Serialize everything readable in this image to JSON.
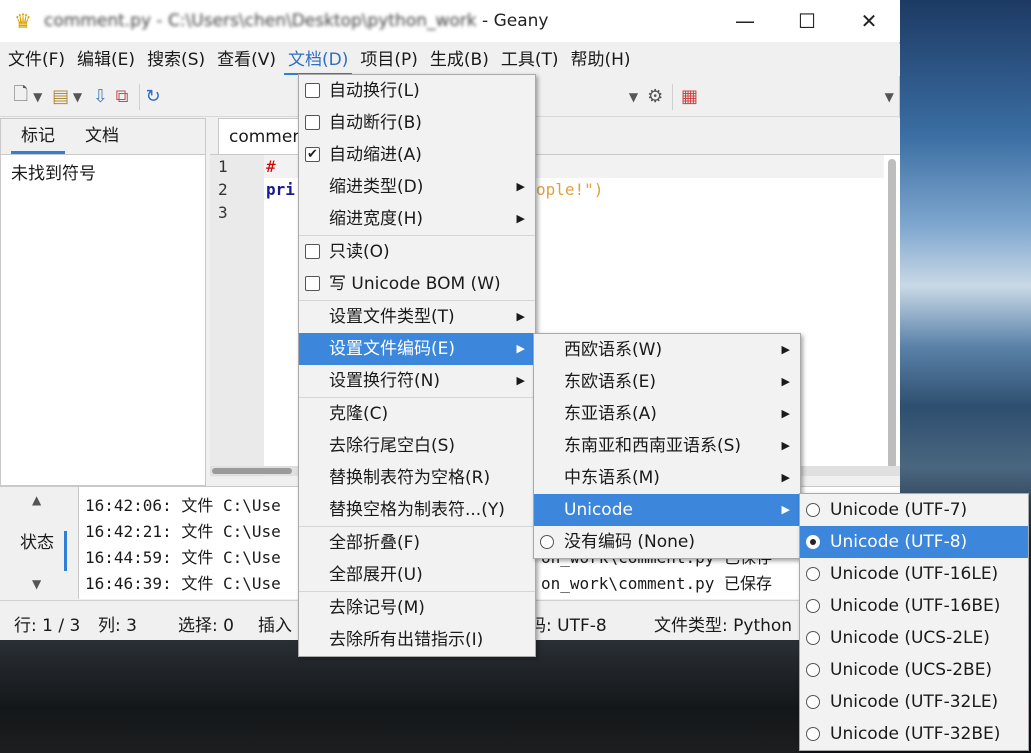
{
  "window": {
    "title_blurred": "comment.py - C:\\Users\\chen\\Desktop\\python_work",
    "title_app": " - Geany",
    "controls": {
      "minimize": "—",
      "maximize": "☐",
      "close": "✕"
    }
  },
  "menubar": [
    "文件(F)",
    "编辑(E)",
    "搜索(S)",
    "查看(V)",
    "文档(D)",
    "项目(P)",
    "生成(B)",
    "工具(T)",
    "帮助(H)"
  ],
  "sidebar": {
    "tabs": [
      "标记",
      "文档"
    ],
    "message": "未找到符号"
  },
  "editor": {
    "tab_label": "commen",
    "line_numbers": [
      "1",
      "2",
      "3"
    ],
    "code": [
      "# ",
      "pri",
      ""
    ],
    "code_tail": "ople!\")"
  },
  "messages": {
    "label": "状态",
    "lines": [
      "16:42:06: 文件 C:\\Use",
      "16:42:21: 文件 C:\\Use",
      "16:44:59: 文件 C:\\Use",
      "16:46:39: 文件 C:\\Use"
    ],
    "tails": [
      "on_work\\comment.py 已保存",
      "on_work\\comment.py 已保存"
    ]
  },
  "statusbar": {
    "line": "行: 1 / 3",
    "col": "列: 3",
    "sel": "选择: 0",
    "mode": "插入",
    "encoding": "编码: UTF-8",
    "filetype": "文件类型: Python"
  },
  "doc_menu": {
    "items": [
      {
        "label": "自动换行(L)",
        "check": false
      },
      {
        "label": "自动断行(B)",
        "check": false
      },
      {
        "label": "自动缩进(A)",
        "check": true
      },
      {
        "label": "缩进类型(D)",
        "sub": true
      },
      {
        "label": "缩进宽度(H)",
        "sub": true
      },
      {
        "sep": true
      },
      {
        "label": "只读(O)",
        "check": false
      },
      {
        "label": "写 Unicode BOM (W)",
        "check": false
      },
      {
        "sep": true
      },
      {
        "label": "设置文件类型(T)",
        "sub": true
      },
      {
        "label": "设置文件编码(E)",
        "sub": true,
        "hl": true
      },
      {
        "label": "设置换行符(N)",
        "sub": true
      },
      {
        "sep": true
      },
      {
        "label": "克隆(C)"
      },
      {
        "label": "去除行尾空白(S)"
      },
      {
        "label": "替换制表符为空格(R)"
      },
      {
        "label": "替换空格为制表符...(Y)"
      },
      {
        "sep": true
      },
      {
        "label": "全部折叠(F)"
      },
      {
        "label": "全部展开(U)"
      },
      {
        "sep": true
      },
      {
        "label": "去除记号(M)"
      },
      {
        "label": "去除所有出错指示(I)"
      }
    ]
  },
  "encoding_menu": {
    "items": [
      {
        "label": "西欧语系(W)",
        "sub": true
      },
      {
        "label": "东欧语系(E)",
        "sub": true
      },
      {
        "label": "东亚语系(A)",
        "sub": true
      },
      {
        "label": "东南亚和西南亚语系(S)",
        "sub": true
      },
      {
        "label": "中东语系(M)",
        "sub": true
      },
      {
        "label": "Unicode",
        "sub": true,
        "hl": true
      },
      {
        "label": "没有编码 (None)",
        "radio": false
      }
    ]
  },
  "unicode_menu": {
    "items": [
      {
        "label": "Unicode (UTF-7)",
        "radio": false
      },
      {
        "label": "Unicode (UTF-8)",
        "radio": true,
        "hl": true
      },
      {
        "label": "Unicode (UTF-16LE)",
        "radio": false
      },
      {
        "label": "Unicode (UTF-16BE)",
        "radio": false
      },
      {
        "label": "Unicode (UCS-2LE)",
        "radio": false
      },
      {
        "label": "Unicode (UCS-2BE)",
        "radio": false
      },
      {
        "label": "Unicode (UTF-32LE)",
        "radio": false
      },
      {
        "label": "Unicode (UTF-32BE)",
        "radio": false
      }
    ]
  },
  "colors": {
    "accent": "#3c86dc",
    "comment": "#d00000",
    "keyword": "#1a1a8c",
    "string": "#e0a040"
  }
}
